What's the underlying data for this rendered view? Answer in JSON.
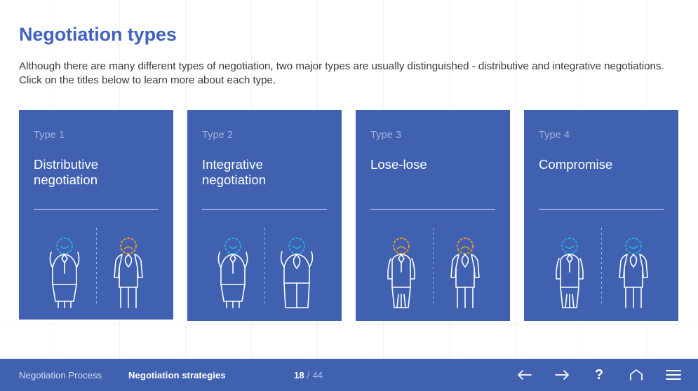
{
  "header": {
    "title": "Negotiation types",
    "intro": "Although there are many different types of negotiation, two major types are usually distinguished - distributive and integrative negotiations. Click on the titles below to learn more about each type."
  },
  "theme": {
    "brand_blue": "#4060b0",
    "title_blue": "#4163c0",
    "happy_accent": "#29a8df",
    "sad_accent": "#e8962e",
    "grid_line": "#f1f2f5"
  },
  "cards": [
    {
      "type_label": "Type 1",
      "title": "Distributive negotiation",
      "left_figure": {
        "mood": "happy",
        "pose": "arms-up",
        "attire": "skirt",
        "accent": "#29a8df"
      },
      "right_figure": {
        "mood": "sad",
        "pose": "arms-down",
        "attire": "suit",
        "accent": "#e8962e"
      }
    },
    {
      "type_label": "Type 2",
      "title": "Integrative negotiation",
      "left_figure": {
        "mood": "happy",
        "pose": "arms-up",
        "attire": "skirt",
        "accent": "#29a8df"
      },
      "right_figure": {
        "mood": "happy",
        "pose": "arms-up",
        "attire": "suit",
        "accent": "#29a8df"
      }
    },
    {
      "type_label": "Type 3",
      "title": "Lose-lose",
      "left_figure": {
        "mood": "sad",
        "pose": "arms-down",
        "attire": "skirt",
        "accent": "#e8962e"
      },
      "right_figure": {
        "mood": "sad",
        "pose": "arms-down",
        "attire": "suit",
        "accent": "#e8962e"
      }
    },
    {
      "type_label": "Type 4",
      "title": "Compromise",
      "left_figure": {
        "mood": "happy",
        "pose": "arms-down",
        "attire": "skirt",
        "accent": "#29a8df"
      },
      "right_figure": {
        "mood": "happy",
        "pose": "arms-down",
        "attire": "suit",
        "accent": "#29a8df"
      }
    }
  ],
  "footer": {
    "breadcrumb_parent": "Negotiation Process",
    "breadcrumb_current": "Negotiation strategies",
    "page_current": "18",
    "page_separator": "/",
    "page_total": "44",
    "controls": [
      {
        "name": "previous-button",
        "icon": "arrow-left-icon"
      },
      {
        "name": "next-button",
        "icon": "arrow-right-icon"
      },
      {
        "name": "help-button",
        "icon": "question-mark-icon",
        "glyph": "?"
      },
      {
        "name": "home-button",
        "icon": "home-icon"
      },
      {
        "name": "menu-button",
        "icon": "hamburger-menu-icon"
      }
    ]
  }
}
